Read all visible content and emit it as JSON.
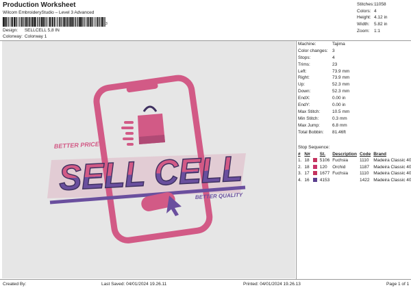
{
  "header": {
    "title": "Production Worksheet",
    "subtitle": "Wilcom EmbroideryStudio – Level 3 Advanced",
    "barcode_digit": "3"
  },
  "design": {
    "label": "Design:",
    "value": "SELLCELL 5,8 IN"
  },
  "colorway": {
    "label": "Colorway:",
    "value": "Colorway 1"
  },
  "stats": [
    {
      "label": "Stitches:",
      "value": "11058"
    },
    {
      "label": "Colors:",
      "value": "4"
    },
    {
      "label": "Height:",
      "value": "4.12 in"
    },
    {
      "label": "Width:",
      "value": "5.82 in"
    },
    {
      "label": "Zoom:",
      "value": "1:1"
    }
  ],
  "machine_info": [
    {
      "label": "Machine:",
      "value": "Tajima"
    },
    {
      "label": "Color changes:",
      "value": "3"
    },
    {
      "label": "Stops:",
      "value": "4"
    },
    {
      "label": "Trims:",
      "value": "23"
    },
    {
      "label": "Left:",
      "value": "73.9 mm"
    },
    {
      "label": "Right:",
      "value": "73.9 mm"
    },
    {
      "label": "Up:",
      "value": "52.3 mm"
    },
    {
      "label": "Down:",
      "value": "52.3 mm"
    },
    {
      "label": "EndX:",
      "value": "0.00 in"
    },
    {
      "label": "EndY:",
      "value": "0.00 in"
    },
    {
      "label": "Max Stitch:",
      "value": "10.5 mm"
    },
    {
      "label": "Min Stitch:",
      "value": "0.3 mm"
    },
    {
      "label": "Max Jump:",
      "value": "6.8 mm"
    },
    {
      "label": "Total Bobbin:",
      "value": "81.46ft"
    }
  ],
  "stop_sequence": {
    "title": "Stop Sequence:",
    "headers": [
      "#",
      "N#",
      "",
      "St.",
      "Description",
      "Code",
      "Brand"
    ],
    "rows": [
      {
        "num": "1.",
        "n": "18",
        "color": "#c4335f",
        "st": "5106",
        "desc": "Fuchsia",
        "code": "1110",
        "brand": "Madeira Classic 40"
      },
      {
        "num": "2.",
        "n": "18",
        "color": "#c8336a",
        "st": "120",
        "desc": "Orchid",
        "code": "1187",
        "brand": "Madeira Classic 40"
      },
      {
        "num": "3.",
        "n": "17",
        "color": "#c4335f",
        "st": "1677",
        "desc": "Fuchsia",
        "code": "1110",
        "brand": "Madeira Classic 40"
      },
      {
        "num": "4.",
        "n": "16",
        "color": "#5b3f8f",
        "st": "4153",
        "desc": "",
        "code": "1422",
        "brand": "Madeira Classic 40"
      }
    ]
  },
  "design_art": {
    "main_text": "SELL CELL",
    "tag_top": "BETTER PRICES",
    "tag_bottom": "BETTER QUALITY",
    "pink": "#d25a86",
    "purple": "#6a4f9e",
    "dark": "#3f3060"
  },
  "footer": {
    "created_by": "Created By:",
    "last_saved": "Last Saved: 04/01/2024 19.26.11",
    "printed": "Printed: 04/01/2024 19.26.13",
    "page": "Page 1 of 1"
  }
}
